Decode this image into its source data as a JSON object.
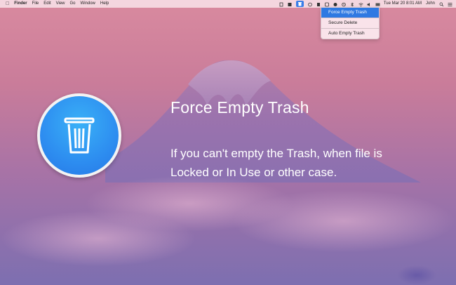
{
  "menubar": {
    "apple": "",
    "app_name": "Finder",
    "menus": [
      "File",
      "Edit",
      "View",
      "Go",
      "Window",
      "Help"
    ],
    "clock": "Tue Mar 20  8:01 AM",
    "user": "John"
  },
  "dropdown": {
    "items": [
      "Force Empty Trash",
      "Secure Delete",
      "Auto Empty Trash"
    ],
    "active_index": 0
  },
  "hero": {
    "title": "Force Empty Trash",
    "description_line1": "If you can't empty the Trash, when file is",
    "description_line2": "Locked or In Use or other case."
  },
  "icons": {
    "app": "trash-icon",
    "menu_tray": "trash-tray-icon"
  },
  "colors": {
    "accent": "#2f79e2",
    "icon_blue": "#2d8df0"
  }
}
